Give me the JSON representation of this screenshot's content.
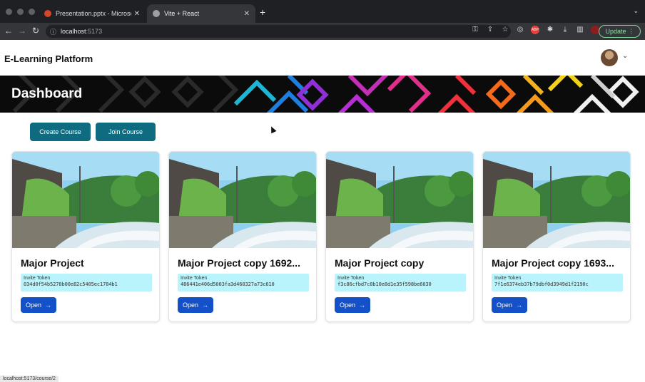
{
  "browser": {
    "tabs": [
      {
        "title": "Presentation.pptx - Microsoft P",
        "active": false
      },
      {
        "title": "Vite + React",
        "active": true
      }
    ],
    "url_host": "localhost",
    "url_port": ":5173",
    "update_label": "Update",
    "status_url": "localhost:5173/course/2"
  },
  "app": {
    "brand": "E-Learning Platform",
    "banner_title": "Dashboard",
    "actions": {
      "create": "Create Course",
      "join": "Join Course"
    }
  },
  "courses": [
    {
      "title": "Major Project",
      "token_label": "Invite Token",
      "token": "034d0f54b5278b00e82c5405ec1784b1",
      "open_label": "Open"
    },
    {
      "title": "Major Project copy 1692...",
      "token_label": "Invite Token",
      "token": "486441e406d5003fa3d460327a73c610",
      "open_label": "Open"
    },
    {
      "title": "Major Project copy",
      "token_label": "Invite Token",
      "token": "f3c86cfbd7c8b10e8d1e35f598be6030",
      "open_label": "Open"
    },
    {
      "title": "Major Project copy 1693...",
      "token_label": "Invite Token",
      "token": "7f1e6374eb37b79dbf0d3949d1f2190c",
      "open_label": "Open"
    }
  ],
  "colors": {
    "accent_teal": "#0f6b7f",
    "open_blue": "#1450c8",
    "token_bg": "#b9f3fb"
  }
}
